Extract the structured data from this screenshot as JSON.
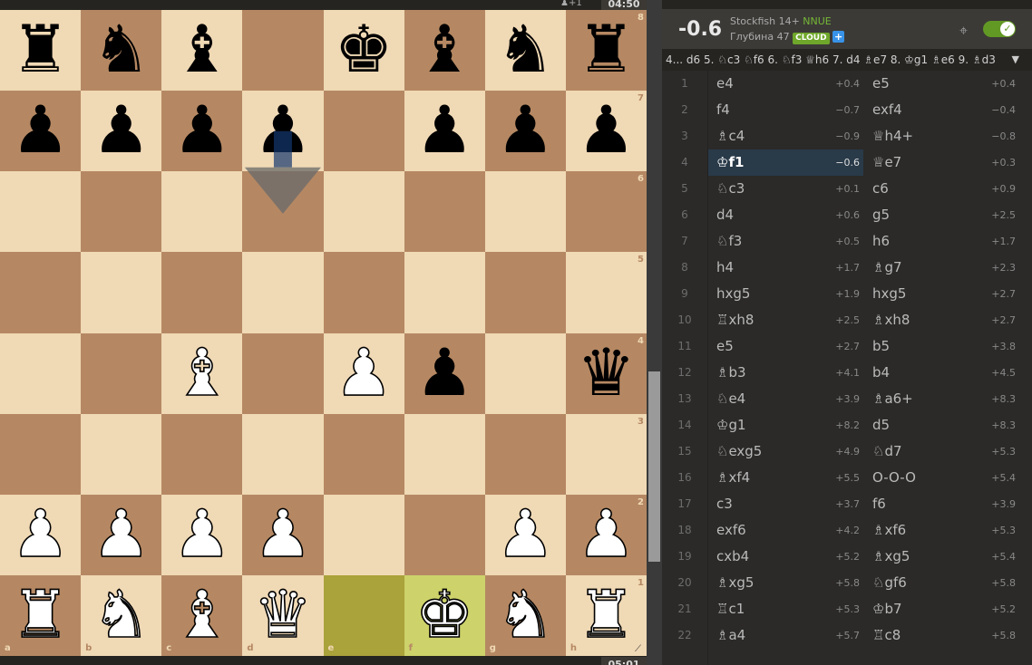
{
  "clocks": {
    "top": "04:50",
    "bottom": "05:01",
    "top_material": "♟+1"
  },
  "board": {
    "files": [
      "a",
      "b",
      "c",
      "d",
      "e",
      "f",
      "g",
      "h"
    ],
    "ranks": [
      "8",
      "7",
      "6",
      "5",
      "4",
      "3",
      "2",
      "1"
    ],
    "highlight_from": "e1",
    "highlight_to": "f1",
    "pieces": [
      {
        "square": "a8",
        "glyph": "♜",
        "color": "b",
        "name": "black-rook"
      },
      {
        "square": "b8",
        "glyph": "♞",
        "color": "b",
        "name": "black-knight"
      },
      {
        "square": "c8",
        "glyph": "♝",
        "color": "b",
        "name": "black-bishop"
      },
      {
        "square": "e8",
        "glyph": "♚",
        "color": "b",
        "name": "black-king"
      },
      {
        "square": "f8",
        "glyph": "♝",
        "color": "b",
        "name": "black-bishop"
      },
      {
        "square": "g8",
        "glyph": "♞",
        "color": "b",
        "name": "black-knight"
      },
      {
        "square": "h8",
        "glyph": "♜",
        "color": "b",
        "name": "black-rook"
      },
      {
        "square": "a7",
        "glyph": "♟",
        "color": "b",
        "name": "black-pawn"
      },
      {
        "square": "b7",
        "glyph": "♟",
        "color": "b",
        "name": "black-pawn"
      },
      {
        "square": "c7",
        "glyph": "♟",
        "color": "b",
        "name": "black-pawn"
      },
      {
        "square": "d7",
        "glyph": "♟",
        "color": "b",
        "name": "black-pawn"
      },
      {
        "square": "f7",
        "glyph": "♟",
        "color": "b",
        "name": "black-pawn"
      },
      {
        "square": "g7",
        "glyph": "♟",
        "color": "b",
        "name": "black-pawn"
      },
      {
        "square": "h7",
        "glyph": "♟",
        "color": "b",
        "name": "black-pawn"
      },
      {
        "square": "c4",
        "glyph": "♝",
        "color": "w",
        "name": "white-bishop"
      },
      {
        "square": "e4",
        "glyph": "♟",
        "color": "w",
        "name": "white-pawn"
      },
      {
        "square": "f4",
        "glyph": "♟",
        "color": "b",
        "name": "black-pawn"
      },
      {
        "square": "h4",
        "glyph": "♛",
        "color": "b",
        "name": "black-queen"
      },
      {
        "square": "a2",
        "glyph": "♟",
        "color": "w",
        "name": "white-pawn"
      },
      {
        "square": "b2",
        "glyph": "♟",
        "color": "w",
        "name": "white-pawn"
      },
      {
        "square": "c2",
        "glyph": "♟",
        "color": "w",
        "name": "white-pawn"
      },
      {
        "square": "d2",
        "glyph": "♟",
        "color": "w",
        "name": "white-pawn"
      },
      {
        "square": "g2",
        "glyph": "♟",
        "color": "w",
        "name": "white-pawn"
      },
      {
        "square": "h2",
        "glyph": "♟",
        "color": "w",
        "name": "white-pawn"
      },
      {
        "square": "a1",
        "glyph": "♜",
        "color": "w",
        "name": "white-rook"
      },
      {
        "square": "b1",
        "glyph": "♞",
        "color": "w",
        "name": "white-knight"
      },
      {
        "square": "c1",
        "glyph": "♝",
        "color": "w",
        "name": "white-bishop"
      },
      {
        "square": "d1",
        "glyph": "♛",
        "color": "w",
        "name": "white-queen"
      },
      {
        "square": "f1",
        "glyph": "♚",
        "color": "w",
        "name": "white-king"
      },
      {
        "square": "g1",
        "glyph": "♞",
        "color": "w",
        "name": "white-knight"
      },
      {
        "square": "h1",
        "glyph": "♜",
        "color": "w",
        "name": "white-rook"
      }
    ],
    "arrow": {
      "from": "d7",
      "to": "d6"
    }
  },
  "engine": {
    "eval": "-0.6",
    "name": "Stockfish 14+",
    "nnue": "NNUE",
    "depth": "Глубина 47",
    "cloud": "CLOUD",
    "plus": "+",
    "toggle_check": "✓",
    "target_icon": "⌖"
  },
  "pv_line": "4... d6 5. ♘c3 ♘f6 6. ♘f3 ♕h6 7. d4 ♗e7 8. ♔g1 ♗e6 9. ♗d3",
  "pv_expand": "▼",
  "colors": {
    "light_square": "#f0d9b5",
    "dark_square": "#b58863",
    "highlight_from": "#aaa23a",
    "highlight_to": "#cdd26a",
    "active_move": "#293a49",
    "toggle_on": "#629924"
  },
  "moves": [
    {
      "n": "1",
      "w": "e4",
      "we": "+0.4",
      "b": "e5",
      "be": "+0.4"
    },
    {
      "n": "2",
      "w": "f4",
      "we": "−0.7",
      "b": "exf4",
      "be": "−0.4"
    },
    {
      "n": "3",
      "w": "♗c4",
      "we": "−0.9",
      "b": "♕h4+",
      "be": "−0.8"
    },
    {
      "n": "4",
      "w": "♔f1",
      "we": "−0.6",
      "b": "♕e7",
      "be": "+0.3",
      "active": "w"
    },
    {
      "n": "5",
      "w": "♘c3",
      "we": "+0.1",
      "b": "c6",
      "be": "+0.9"
    },
    {
      "n": "6",
      "w": "d4",
      "we": "+0.6",
      "b": "g5",
      "be": "+2.5"
    },
    {
      "n": "7",
      "w": "♘f3",
      "we": "+0.5",
      "b": "h6",
      "be": "+1.7"
    },
    {
      "n": "8",
      "w": "h4",
      "we": "+1.7",
      "b": "♗g7",
      "be": "+2.3"
    },
    {
      "n": "9",
      "w": "hxg5",
      "we": "+1.9",
      "b": "hxg5",
      "be": "+2.7"
    },
    {
      "n": "10",
      "w": "♖xh8",
      "we": "+2.5",
      "b": "♗xh8",
      "be": "+2.7"
    },
    {
      "n": "11",
      "w": "e5",
      "we": "+2.7",
      "b": "b5",
      "be": "+3.8"
    },
    {
      "n": "12",
      "w": "♗b3",
      "we": "+4.1",
      "b": "b4",
      "be": "+4.5"
    },
    {
      "n": "13",
      "w": "♘e4",
      "we": "+3.9",
      "b": "♗a6+",
      "be": "+8.3"
    },
    {
      "n": "14",
      "w": "♔g1",
      "we": "+8.2",
      "b": "d5",
      "be": "+8.3"
    },
    {
      "n": "15",
      "w": "♘exg5",
      "we": "+4.9",
      "b": "♘d7",
      "be": "+5.3"
    },
    {
      "n": "16",
      "w": "♗xf4",
      "we": "+5.5",
      "b": "O-O-O",
      "be": "+5.4"
    },
    {
      "n": "17",
      "w": "c3",
      "we": "+3.7",
      "b": "f6",
      "be": "+3.9"
    },
    {
      "n": "18",
      "w": "exf6",
      "we": "+4.2",
      "b": "♗xf6",
      "be": "+5.3"
    },
    {
      "n": "19",
      "w": "cxb4",
      "we": "+5.2",
      "b": "♗xg5",
      "be": "+5.4"
    },
    {
      "n": "20",
      "w": "♗xg5",
      "we": "+5.8",
      "b": "♘gf6",
      "be": "+5.8"
    },
    {
      "n": "21",
      "w": "♖c1",
      "we": "+5.3",
      "b": "♔b7",
      "be": "+5.2"
    },
    {
      "n": "22",
      "w": "♗a4",
      "we": "+5.7",
      "b": "♖c8",
      "be": "+5.8"
    }
  ]
}
